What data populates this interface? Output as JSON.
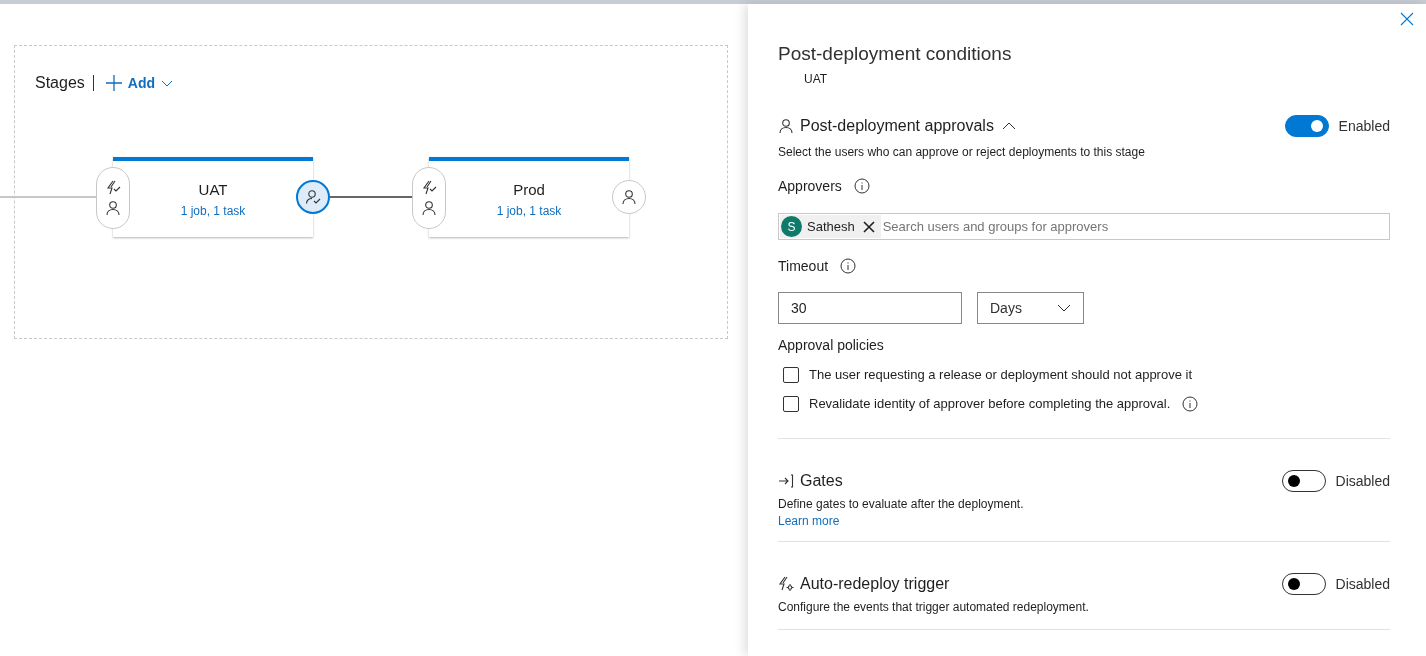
{
  "stages_header": {
    "title": "Stages",
    "add_label": "Add"
  },
  "stages": [
    {
      "name": "UAT",
      "summary": "1 job, 1 task",
      "post_selected": true
    },
    {
      "name": "Prod",
      "summary": "1 job, 1 task",
      "post_selected": false
    }
  ],
  "panel": {
    "title": "Post-deployment conditions",
    "stage": "UAT",
    "approvals": {
      "title": "Post-deployment approvals",
      "expanded": true,
      "on": true,
      "state_label": "Enabled",
      "description": "Select the users who can approve or reject deployments to this stage",
      "approvers_label": "Approvers",
      "approvers": [
        {
          "initial": "S",
          "name": "Sathesh"
        }
      ],
      "search_placeholder": "Search users and groups for approvers",
      "timeout_label": "Timeout",
      "timeout_value": "30",
      "timeout_unit": "Days",
      "policies_label": "Approval policies",
      "policies": [
        {
          "label": "The user requesting a release or deployment should not approve it",
          "checked": false,
          "info": false
        },
        {
          "label": "Revalidate identity of approver before completing the approval.",
          "checked": false,
          "info": true
        }
      ]
    },
    "sections": [
      {
        "kind": "gates",
        "title": "Gates",
        "on": false,
        "state_label": "Disabled",
        "description": "Define gates to evaluate after the deployment.",
        "link": "Learn more"
      },
      {
        "kind": "trigger",
        "title": "Auto-redeploy trigger",
        "on": false,
        "state_label": "Disabled",
        "description": "Configure the events that trigger automated redeployment."
      }
    ]
  }
}
